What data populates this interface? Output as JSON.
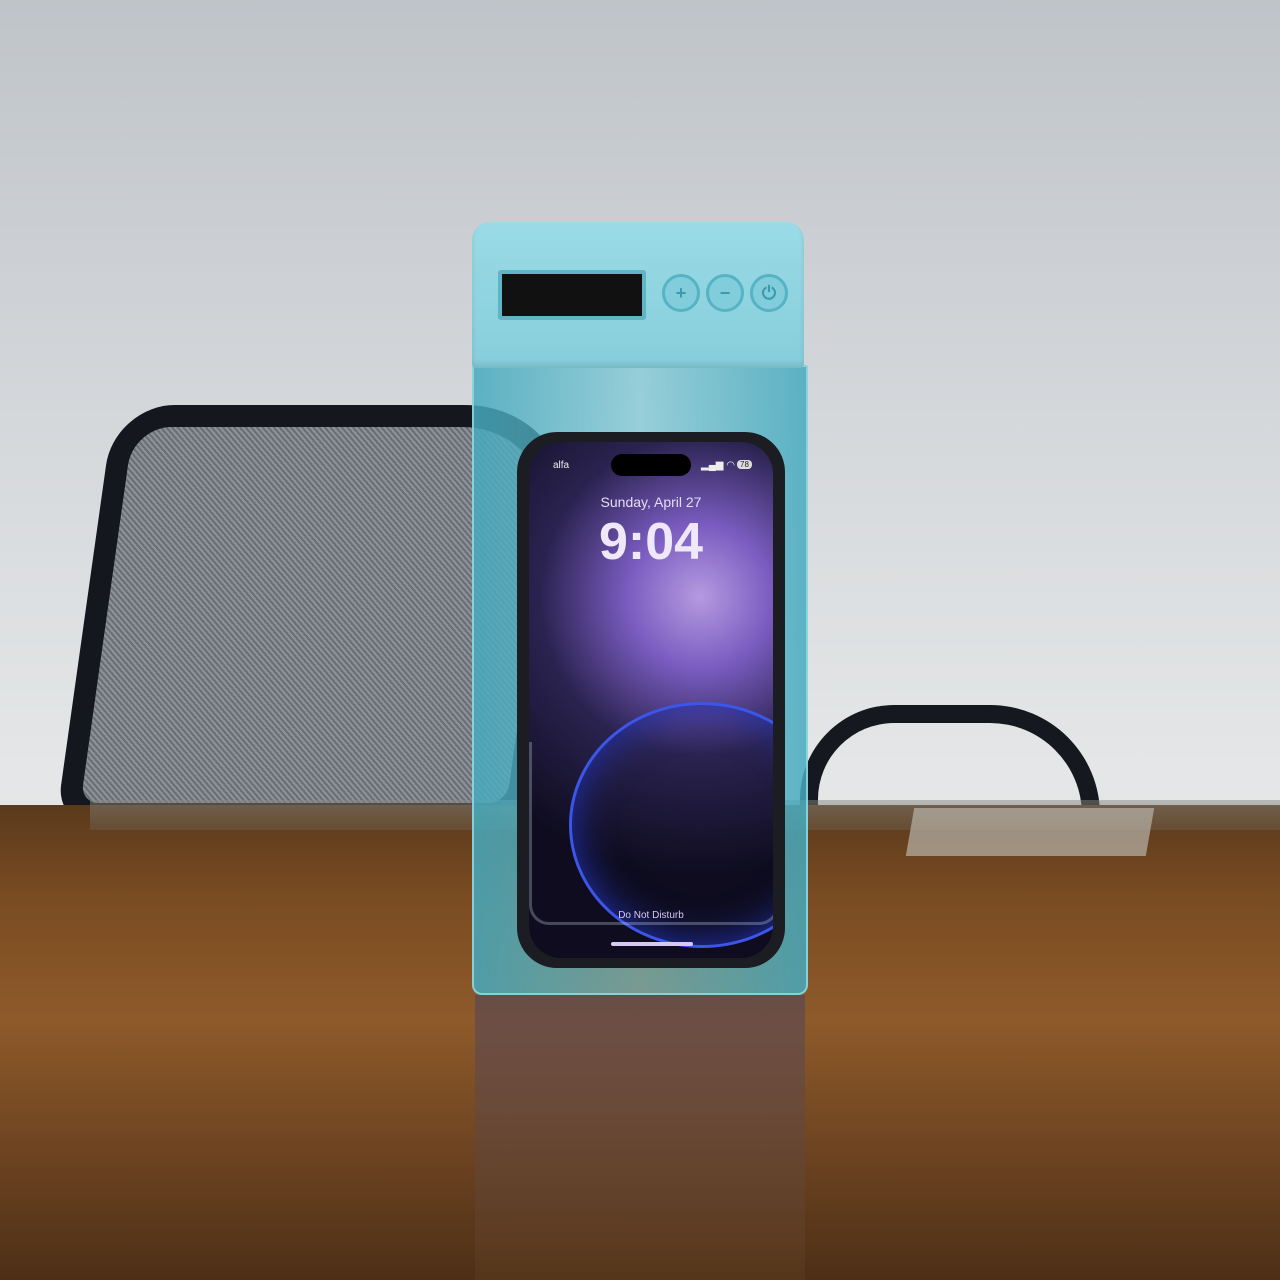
{
  "device": {
    "buttons": [
      "+",
      "−",
      "⏻"
    ],
    "phone": {
      "carrier": "alfa",
      "battery": "78",
      "date": "Sunday, April 27",
      "time": "9:04",
      "focus_mode": "Do Not Disturb"
    }
  },
  "colors": {
    "device_blue": "#8fd3e0",
    "wall": "#d6d9dc",
    "table": "#7a4c22"
  }
}
